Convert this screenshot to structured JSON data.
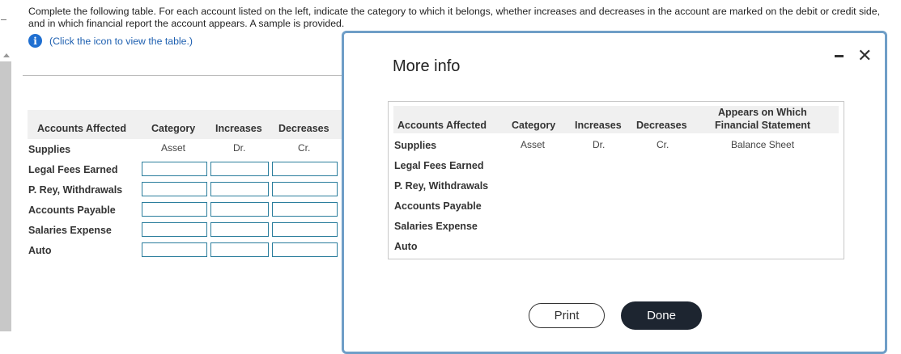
{
  "instructions": "Complete the following table. For each account listed on the left, indicate the category to which it belongs, whether increases and decreases in the account are marked on the debit or credit side, and in which financial report the account appears. A sample is provided.",
  "info_icon_glyph": "i",
  "info_link": "(Click the icon to view the table.)",
  "table": {
    "headers": {
      "account": "Accounts Affected",
      "category": "Category",
      "increases": "Increases",
      "decreases": "Decreases"
    },
    "sample": {
      "account": "Supplies",
      "category": "Asset",
      "increases": "Dr.",
      "decreases": "Cr."
    },
    "rows": [
      "Legal Fees Earned",
      "P. Rey, Withdrawals",
      "Accounts Payable",
      "Salaries Expense",
      "Auto"
    ]
  },
  "modal": {
    "title": "More info",
    "close_glyph": "✕",
    "headers": {
      "account": "Accounts Affected",
      "category": "Category",
      "increases": "Increases",
      "decreases": "Decreases",
      "statement_line1": "Appears on Which",
      "statement_line2": "Financial Statement"
    },
    "sample": {
      "account": "Supplies",
      "category": "Asset",
      "increases": "Dr.",
      "decreases": "Cr.",
      "statement": "Balance Sheet"
    },
    "rows": [
      "Legal Fees Earned",
      "P. Rey, Withdrawals",
      "Accounts Payable",
      "Salaries Expense",
      "Auto"
    ],
    "print_label": "Print",
    "done_label": "Done"
  }
}
